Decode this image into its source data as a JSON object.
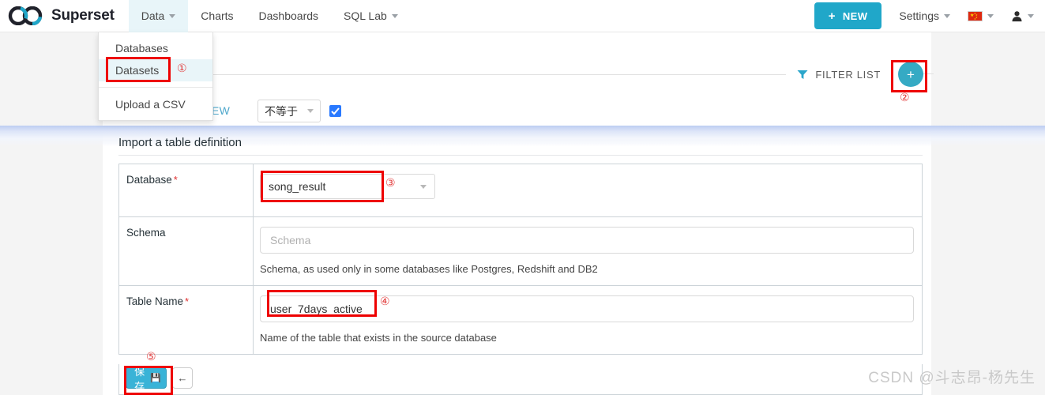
{
  "navbar": {
    "brand": "Superset",
    "brand_logo_icon": "superset-infinity-logo",
    "items": [
      {
        "label": "Data",
        "has_caret": true,
        "active": true
      },
      {
        "label": "Charts",
        "has_caret": false,
        "active": false
      },
      {
        "label": "Dashboards",
        "has_caret": false,
        "active": false
      },
      {
        "label": "SQL Lab",
        "has_caret": true,
        "active": false
      }
    ],
    "new_button": {
      "label": "NEW",
      "plus": "+",
      "color": "#20a7c9"
    },
    "settings": {
      "label": "Settings"
    },
    "language": {
      "icon": "china-flag-icon"
    },
    "user": {
      "icon": "user-avatar-icon"
    }
  },
  "dropdown": {
    "items": [
      {
        "label": "Databases",
        "hovered": false
      },
      {
        "label": "Datasets",
        "hovered": true
      },
      {
        "label": "Upload a CSV",
        "hovered": false
      }
    ]
  },
  "list_controls": {
    "filter_icon": "filter-funnel-icon",
    "filter_label": "FILTER LIST",
    "add_button_label": "+",
    "add_button_color": "#35aac4"
  },
  "sql_lab_row": {
    "view_link": "SQL LAB VIEW",
    "operator_select": "不等于",
    "checkbox_checked": true
  },
  "form": {
    "title": "Import a table definition",
    "rows": [
      {
        "label": "Database",
        "required": true,
        "value": "song_result",
        "placeholder": "",
        "help": "",
        "control": "select"
      },
      {
        "label": "Schema",
        "required": false,
        "value": "",
        "placeholder": "Schema",
        "help": "Schema, as used only in some databases like Postgres, Redshift and DB2",
        "control": "input"
      },
      {
        "label": "Table Name",
        "required": true,
        "value": "user_7days_active",
        "placeholder": "",
        "help": "Name of the table that exists in the source database",
        "control": "input"
      }
    ],
    "save_button": {
      "label": "保存",
      "icon": "save-floppy-icon"
    },
    "back_button": {
      "icon": "arrow-left-icon"
    }
  },
  "annotations": {
    "marker_1": "①",
    "marker_2": "②",
    "marker_3": "③",
    "marker_4": "④",
    "marker_5": "⑤",
    "highlight_color": "#ee0000"
  },
  "watermark": "CSDN @斗志昂-杨先生"
}
